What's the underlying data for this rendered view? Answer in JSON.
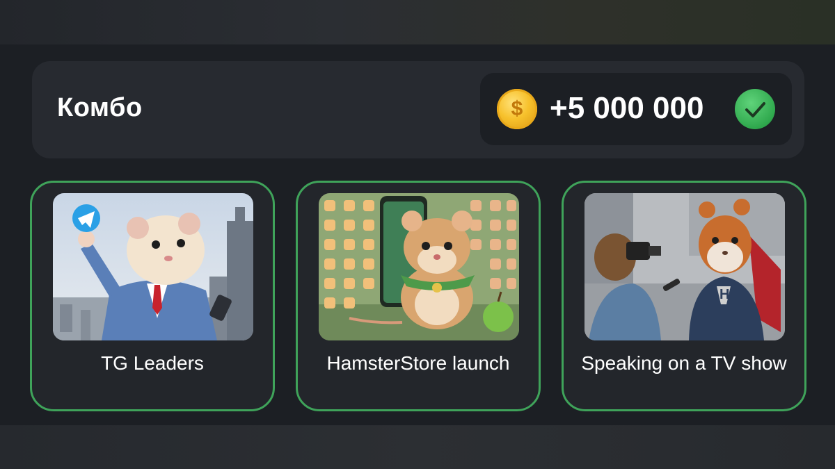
{
  "combo": {
    "title": "Комбо",
    "reward": "+5 000 000",
    "coin_icon": "dollar-coin-icon",
    "status_icon": "checkmark-icon",
    "accent_color": "#3fa35a"
  },
  "cards": [
    {
      "label": "TG Leaders",
      "image": "hamster-businessman-with-telegram-logo"
    },
    {
      "label": "HamsterStore launch",
      "image": "hamster-with-phone-app-icons-and-apple"
    },
    {
      "label": "Speaking on a TV show",
      "image": "hamster-superhero-interviewed-by-reporter"
    }
  ]
}
